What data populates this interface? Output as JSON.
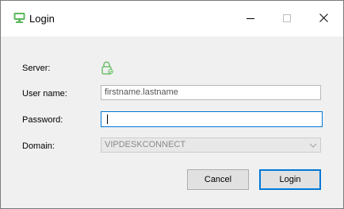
{
  "window": {
    "title": "Login",
    "icon": "login-app-icon",
    "controls": [
      "minimize-icon",
      "maximize-icon",
      "close-icon"
    ]
  },
  "form": {
    "server_label": "Server:",
    "server_icon": "lock-icon",
    "username_label": "User name:",
    "username_value": "firstname.lastname",
    "password_label": "Password:",
    "password_value": "",
    "domain_label": "Domain:",
    "domain_value": "VIPDESKCONNECT"
  },
  "buttons": {
    "cancel_label": "Cancel",
    "login_label": "Login"
  },
  "colors": {
    "accent": "#0078d7",
    "icon_green": "#5cb85c"
  }
}
